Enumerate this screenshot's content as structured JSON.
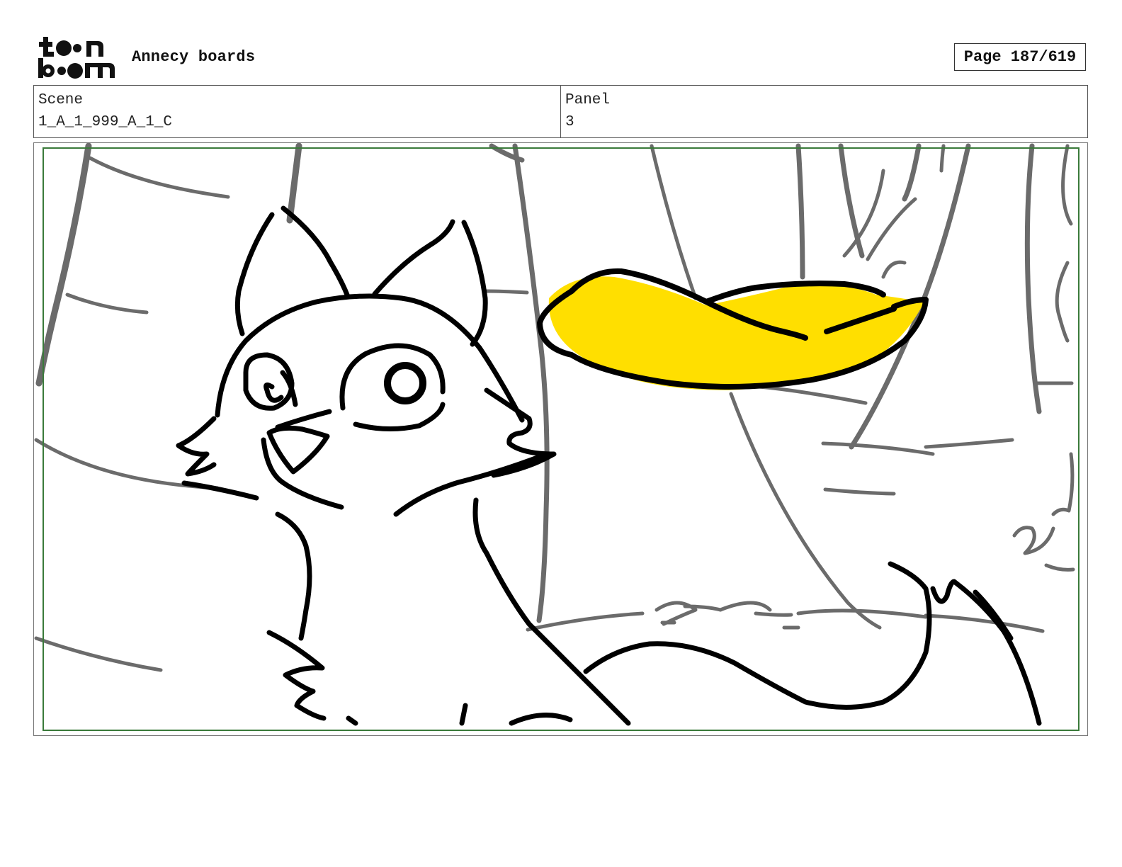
{
  "header": {
    "logo_text": "toon boom",
    "title": "Annecy boards",
    "page_label": "Page 187/619"
  },
  "info": {
    "scene_label": "Scene",
    "scene_value": "1_A_1_999_A_1_C",
    "panel_label": "Panel",
    "panel_value": "3"
  },
  "colors": {
    "ink": "#000000",
    "background_lines": "#6b6b6b",
    "banana_fill": "#ffdf00",
    "safe_frame": "#3a7a3a"
  }
}
